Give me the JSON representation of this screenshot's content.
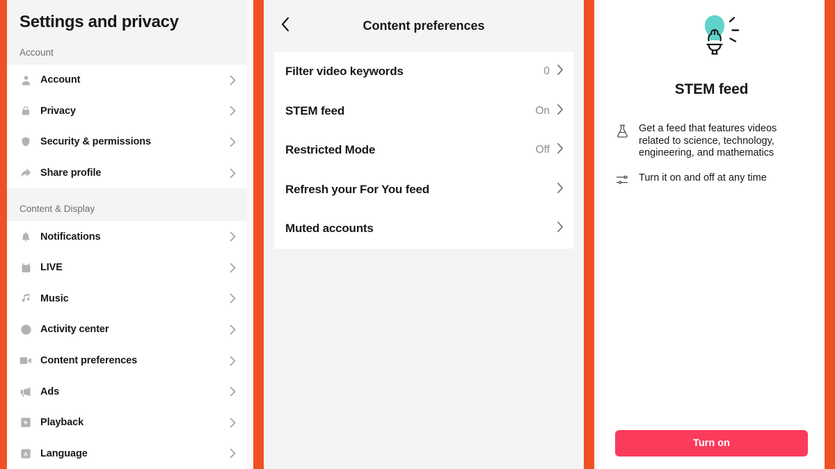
{
  "theme": {
    "divider_orange": "#EF5125",
    "cta_pink": "#FB3B5C",
    "bulb_teal": "#5FD3CB",
    "panel_bg": "#F4F4F4",
    "card_bg": "#FFFFFF"
  },
  "sidebar": {
    "title": "Settings and privacy",
    "sections": [
      {
        "label": "Account",
        "items": [
          {
            "label": "Account",
            "icon": "person-icon",
            "chevron": "chevron-right-icon"
          },
          {
            "label": "Privacy",
            "icon": "lock-icon",
            "chevron": "chevron-right-icon"
          },
          {
            "label": "Security & permissions",
            "icon": "shield-icon",
            "chevron": "chevron-right-icon"
          },
          {
            "label": "Share profile",
            "icon": "share-arrow-icon",
            "chevron": "chevron-right-icon"
          }
        ]
      },
      {
        "label": "Content & Display",
        "items": [
          {
            "label": "Notifications",
            "icon": "bell-icon",
            "chevron": "chevron-right-icon"
          },
          {
            "label": "LIVE",
            "icon": "live-tv-icon",
            "chevron": "chevron-right-icon"
          },
          {
            "label": "Music",
            "icon": "music-note-icon",
            "chevron": "chevron-right-icon"
          },
          {
            "label": "Activity center",
            "icon": "clock-icon",
            "chevron": "chevron-right-icon"
          },
          {
            "label": "Content preferences",
            "icon": "video-camera-icon",
            "chevron": "chevron-right-icon"
          },
          {
            "label": "Ads",
            "icon": "megaphone-icon",
            "chevron": "chevron-right-icon"
          },
          {
            "label": "Playback",
            "icon": "play-box-icon",
            "chevron": "chevron-right-icon"
          },
          {
            "label": "Language",
            "icon": "language-a-icon",
            "chevron": "chevron-right-icon"
          }
        ]
      }
    ]
  },
  "content_preferences": {
    "back_icon": "chevron-left-icon",
    "title": "Content preferences",
    "rows": [
      {
        "label": "Filter video keywords",
        "value": "0"
      },
      {
        "label": "STEM feed",
        "value": "On"
      },
      {
        "label": "Restricted Mode",
        "value": "Off"
      },
      {
        "label": "Refresh your For You feed",
        "value": ""
      },
      {
        "label": "Muted accounts",
        "value": ""
      }
    ]
  },
  "detail": {
    "hero_icon": "lightbulb-icon",
    "title": "STEM feed",
    "features": [
      {
        "icon": "flask-icon",
        "text": "Get a feed that features videos related to science, technology, engineering, and mathematics"
      },
      {
        "icon": "sliders-icon",
        "text": "Turn it on and off at any time"
      }
    ],
    "cta_label": "Turn on"
  }
}
